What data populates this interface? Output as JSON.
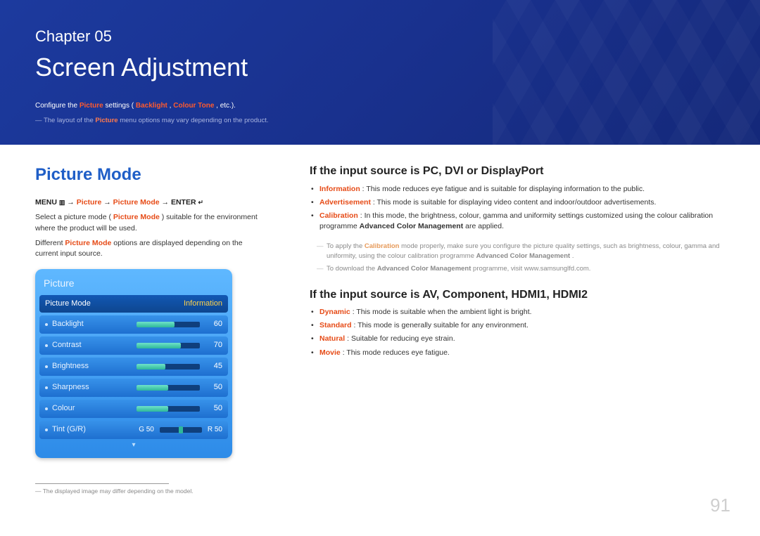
{
  "hero": {
    "chapter_label": "Chapter 05",
    "chapter_title": "Screen Adjustment",
    "sub_pre": "Configure the ",
    "sub_picture": "Picture",
    "sub_mid": " settings (",
    "sub_backlight": "Backlight",
    "sub_sep": ", ",
    "sub_colourtone": "Colour Tone",
    "sub_post": ", etc.).",
    "note_pre": "― The layout of the ",
    "note_picture": "Picture",
    "note_post": " menu options may vary depending on the product."
  },
  "left": {
    "title": "Picture Mode",
    "breadcrumb": {
      "menu": "MENU",
      "menu_icon": "▥",
      "arrow": " → ",
      "picture": "Picture",
      "picture_mode": "Picture Mode",
      "enter": "ENTER",
      "enter_icon": "↵"
    },
    "para1_pre": "Select a picture mode (",
    "para1_pm": "Picture Mode",
    "para1_post": ") suitable for the environment where the product will be used.",
    "para2_pre": "Different ",
    "para2_pm": "Picture Mode",
    "para2_post": " options are displayed depending on the current input source.",
    "osd": {
      "panel_title": "Picture",
      "header_left": "Picture Mode",
      "header_right": "Information",
      "rows": [
        {
          "label": "Backlight",
          "value": "60",
          "pct": 60
        },
        {
          "label": "Contrast",
          "value": "70",
          "pct": 70
        },
        {
          "label": "Brightness",
          "value": "45",
          "pct": 45
        },
        {
          "label": "Sharpness",
          "value": "50",
          "pct": 50
        },
        {
          "label": "Colour",
          "value": "50",
          "pct": 50
        }
      ],
      "tint": {
        "label": "Tint (G/R)",
        "g": "G 50",
        "r": "R 50"
      }
    },
    "footnote": "― The displayed image may differ depending on the model."
  },
  "right": {
    "h1": "If the input source is PC, DVI or DisplayPort",
    "list1": {
      "information_label": "Information",
      "information_desc": ": This mode reduces eye fatigue and is suitable for displaying information to the public.",
      "advertisement_label": "Advertisement",
      "advertisement_desc": ": This mode is suitable for displaying video content and indoor/outdoor advertisements.",
      "calibration_label": "Calibration",
      "calibration_desc_pre": ": In this mode, the brightness, colour, gamma and uniformity settings customized using the colour calibration programme ",
      "calibration_desc_bold": "Advanced Color Management",
      "calibration_desc_post": " are applied."
    },
    "subnotes1": {
      "a_pre": "To apply the ",
      "a_cal": "Calibration",
      "a_mid": " mode properly, make sure you configure the picture quality settings, such as brightness, colour, gamma and uniformity, using the colour calibration programme ",
      "a_bold": "Advanced Color Management",
      "a_post": ".",
      "b_pre": "To download the ",
      "b_bold": "Advanced Color Management",
      "b_post": " programme, visit www.samsunglfd.com."
    },
    "h2": "If the input source is AV, Component, HDMI1, HDMI2",
    "list2": {
      "dynamic_label": "Dynamic",
      "dynamic_desc": ": This mode is suitable when the ambient light is bright.",
      "standard_label": "Standard",
      "standard_desc": ": This mode is generally suitable for any environment.",
      "natural_label": "Natural",
      "natural_desc": ": Suitable for reducing eye strain.",
      "movie_label": "Movie",
      "movie_desc": ": This mode reduces eye fatigue."
    }
  },
  "page_number": "91"
}
